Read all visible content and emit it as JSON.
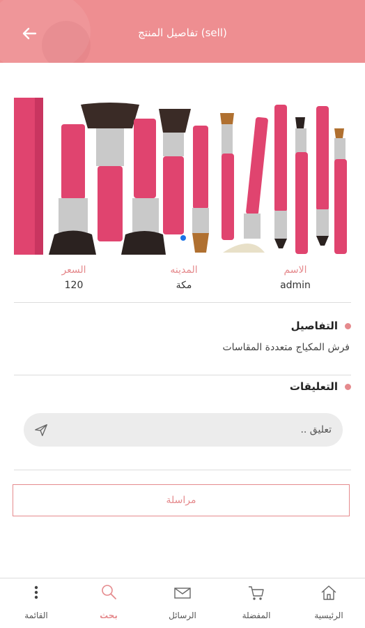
{
  "header": {
    "title": "تفاصيل المنتج (sell)"
  },
  "product_info": {
    "name_label": "الاسم",
    "name_value": "admin",
    "city_label": "المدينه",
    "city_value": "مكة",
    "price_label": "السعر",
    "price_value": "120"
  },
  "details": {
    "title": "التفاصيل",
    "text": "فرش المكياج متعددة المقاسات"
  },
  "comments": {
    "title": "التعليقات",
    "placeholder": "تعليق .."
  },
  "message_button": {
    "label": "مراسلة"
  },
  "bottom_nav": {
    "home": "الرئيسية",
    "favorites": "المفضلة",
    "messages": "الرسائل",
    "search": "بحث",
    "menu": "القائمة"
  },
  "colors": {
    "accent": "#e58a8d",
    "header": "#ee8e91",
    "brush_pink": "#e0446f",
    "carousel_dot": "#1a73e8"
  },
  "icons": [
    "arrow-back-icon",
    "send-icon",
    "home-icon",
    "cart-icon",
    "mail-icon",
    "search-icon",
    "more-vertical-icon"
  ]
}
